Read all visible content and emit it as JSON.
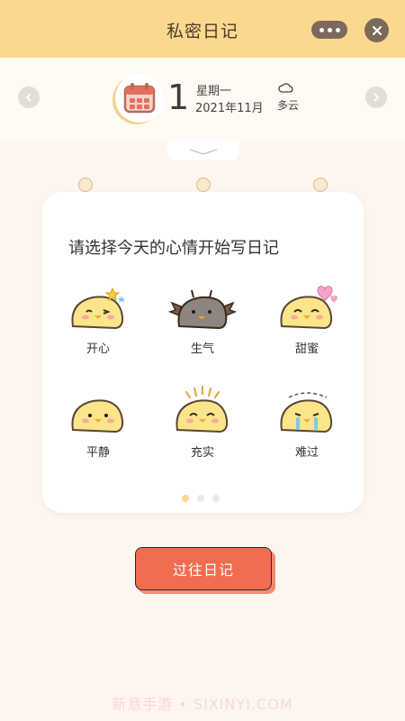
{
  "header": {
    "title": "私密日记",
    "more_icon": "ellipsis-icon",
    "close_icon": "close-icon"
  },
  "date_bar": {
    "day": "1",
    "weekday": "星期一",
    "year_month": "2021年11月",
    "weather": "多云",
    "weather_icon": "cloud-icon",
    "calendar_icon": "calendar-icon",
    "prev_icon": "chevron-left-icon",
    "next_icon": "chevron-right-icon"
  },
  "mood_card": {
    "prompt": "请选择今天的心情开始写日记",
    "moods": [
      {
        "label": "开心",
        "icon": "happy-chick-icon"
      },
      {
        "label": "生气",
        "icon": "angry-chick-icon"
      },
      {
        "label": "甜蜜",
        "icon": "sweet-chick-icon"
      },
      {
        "label": "平静",
        "icon": "calm-chick-icon"
      },
      {
        "label": "充实",
        "icon": "fulfilled-chick-icon"
      },
      {
        "label": "难过",
        "icon": "sad-chick-icon"
      }
    ],
    "page_count": 3,
    "active_page": 1
  },
  "history_button": {
    "label": "过往日记"
  },
  "watermark": "新意手游 • SIXINYI.COM",
  "colors": {
    "header_bg": "#fcd88e",
    "page_bg": "#fdf6ee",
    "button_bg": "#f26c50",
    "control_bg": "#7b6a5a"
  }
}
